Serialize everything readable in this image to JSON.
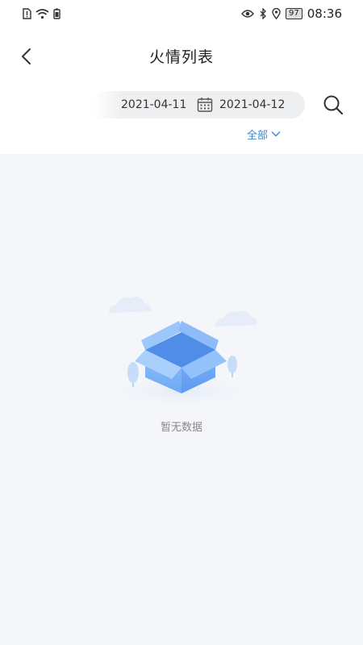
{
  "status_bar": {
    "battery": "97",
    "time": "08:36"
  },
  "header": {
    "title": "火情列表"
  },
  "filter": {
    "start_date": "2021-04-11",
    "end_date": "2021-04-12",
    "category": "全部"
  },
  "empty_state": {
    "message": "暂无数据"
  },
  "colors": {
    "accent": "#3a86d8",
    "background": "#f4f6fa",
    "box": "#6aa8f5"
  }
}
